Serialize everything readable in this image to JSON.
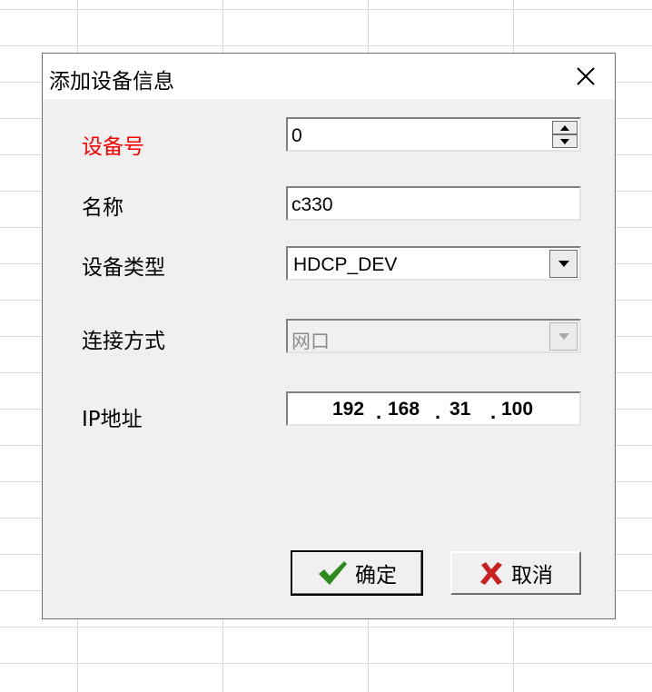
{
  "dialog": {
    "title": "添加设备信息"
  },
  "form": {
    "device_no": {
      "label": "设备号",
      "value": "0"
    },
    "name": {
      "label": "名称",
      "value": "c330"
    },
    "device_type": {
      "label": "设备类型",
      "value": "HDCP_DEV"
    },
    "connection": {
      "label": "连接方式",
      "value": "网口"
    },
    "ip": {
      "label": "IP地址",
      "octets": [
        "192",
        "168",
        "31",
        "100"
      ]
    }
  },
  "buttons": {
    "ok": "确定",
    "cancel": "取消"
  },
  "colors": {
    "required_label": "#ff0000",
    "ok_icon": "#2f8a1d",
    "cancel_icon": "#cc1f1f"
  }
}
